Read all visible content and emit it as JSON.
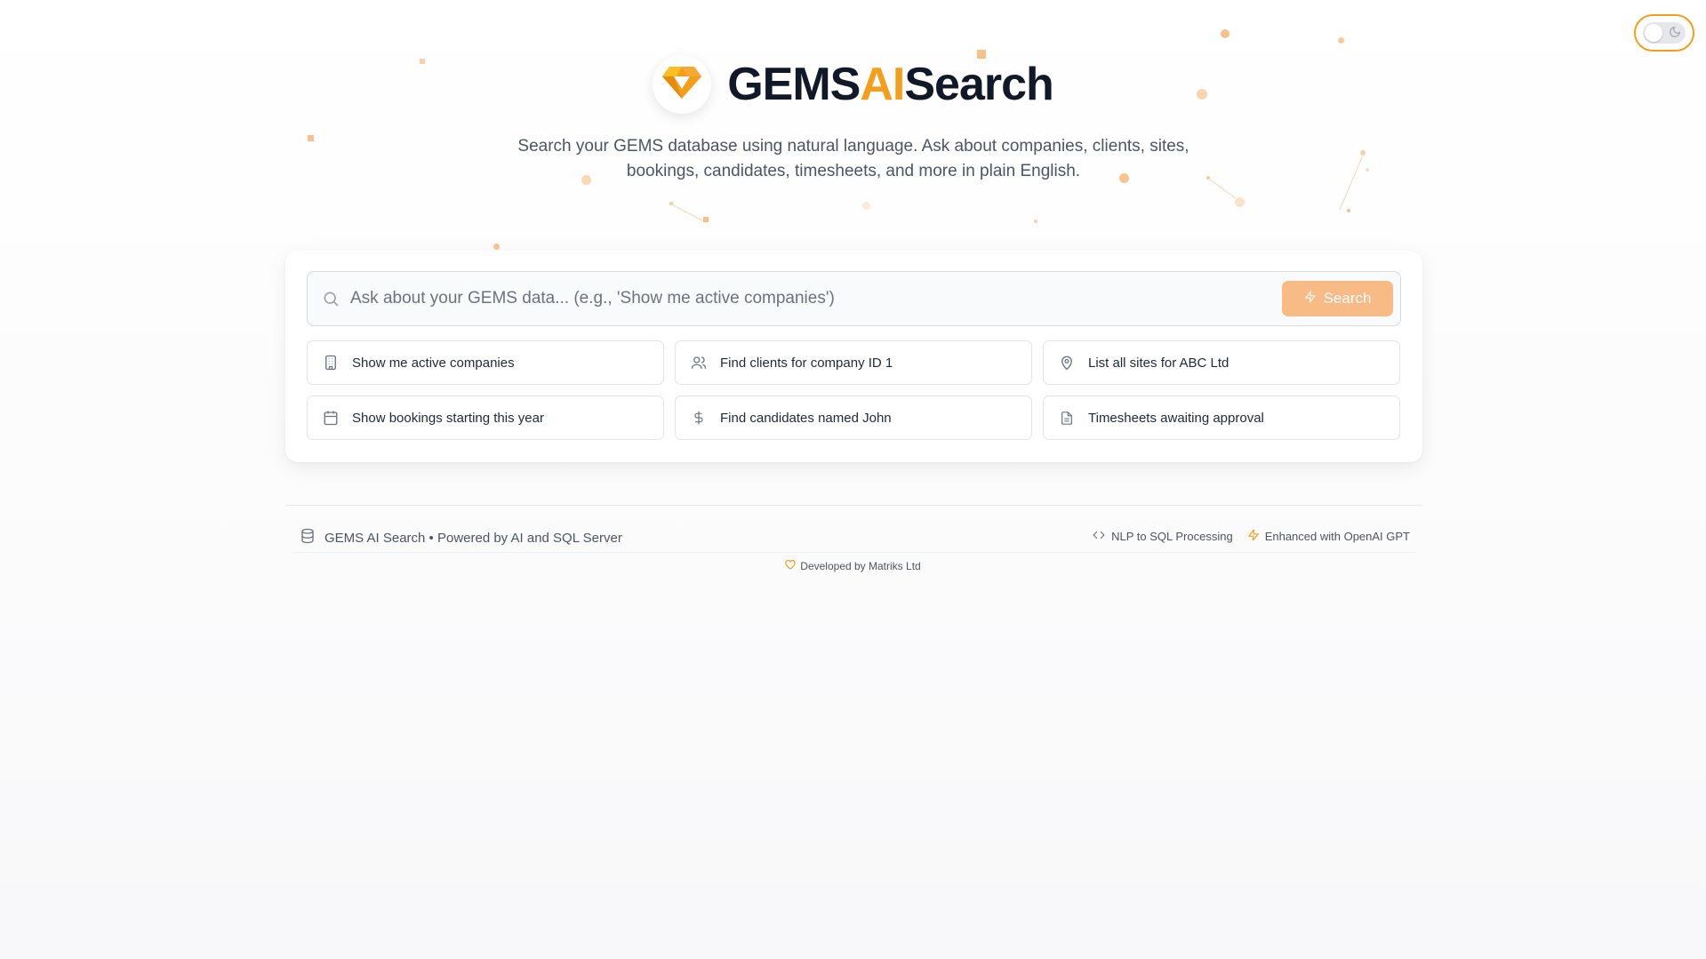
{
  "header": {
    "brand_part1": "GEMS",
    "brand_part2": "AI",
    "brand_part3": "Search",
    "subtitle": "Search your GEMS database using natural language. Ask about companies, clients, sites, bookings, candidates, timesheets, and more in plain English."
  },
  "theme_toggle": {
    "state": "light",
    "icon": "moon-icon"
  },
  "search": {
    "placeholder": "Ask about your GEMS data... (e.g., 'Show me active companies')",
    "value": "",
    "button_label": "Search",
    "button_icon": "lightning-icon"
  },
  "suggestions": [
    {
      "label": "Show me active companies",
      "icon": "building-icon"
    },
    {
      "label": "Find clients for company ID 1",
      "icon": "users-icon"
    },
    {
      "label": "List all sites for ABC Ltd",
      "icon": "map-pin-icon"
    },
    {
      "label": "Show bookings starting this year",
      "icon": "calendar-icon"
    },
    {
      "label": "Find candidates named John",
      "icon": "dollar-icon"
    },
    {
      "label": "Timesheets awaiting approval",
      "icon": "file-text-icon"
    }
  ],
  "footer": {
    "left_text": "GEMS AI Search • Powered by AI and SQL Server",
    "nlp_label": "NLP to SQL Processing",
    "openai_label": "Enhanced with OpenAI GPT",
    "developed_by": "Developed by Matriks Ltd"
  },
  "colors": {
    "accent": "#f59e1b",
    "search_button": "#f8bb85",
    "text_dark": "#111827",
    "text_muted": "#4b5563"
  }
}
